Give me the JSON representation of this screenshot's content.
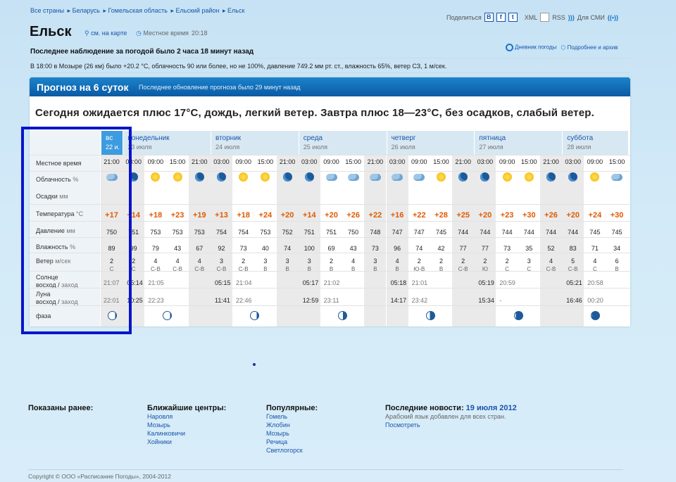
{
  "breadcrumb": [
    "Все страны",
    "Беларусь",
    "Гомельская область",
    "Ельский район",
    "Ельск"
  ],
  "city": "Ельск",
  "map_link": "см. на карте",
  "local_time_label": "Местное время",
  "local_time": "20:18",
  "share": {
    "label": "Поделиться",
    "xml": "XML",
    "rss": "RSS",
    "media": "Для СМИ",
    "b": "B",
    "f": "f",
    "t": "t"
  },
  "last_obs": "Последнее наблюдение за погодой было 2 часа 18 минут назад",
  "links": {
    "diary": "Дневник погоды",
    "archive": "Подробнее и архив"
  },
  "obs_text": "В 18:00 в Мозыре (26 км) было +20.2 °C, облачность 90 или более, но не 100%, давление 749.2 мм рт. ст., влажность 65%, ветер СЗ, 1 м/сек.",
  "forecast": {
    "title": "Прогноз на 6 суток",
    "updated": "Последнее обновление прогноза было 29 минут назад",
    "summary": "Сегодня ожидается плюс 17°C, дождь, легкий ветер. Завтра плюс 18—23°C, без осадков, слабый ветер."
  },
  "labels": {
    "time": "Местное время",
    "cloud": "Облачность",
    "cloud_unit": "%",
    "precip": "Осадки",
    "precip_unit": "мм",
    "temp": "Температура",
    "temp_unit": "°C",
    "press": "Давление",
    "press_unit": "мм",
    "hum": "Влажность",
    "hum_unit": "%",
    "wind": "Ветер",
    "wind_unit": "м/сек",
    "sun": "Солнце",
    "sunrise": "восход",
    "sunset": "заход",
    "moon": "Луна",
    "phase": "фаза"
  },
  "days": [
    {
      "name": "вс",
      "date": "22 и."
    },
    {
      "name": "понедельник",
      "date": "23 июля"
    },
    {
      "name": "вторник",
      "date": "24 июля"
    },
    {
      "name": "среда",
      "date": "25 июля"
    },
    {
      "name": "четверг",
      "date": "26 июля"
    },
    {
      "name": "пятница",
      "date": "27 июля"
    },
    {
      "name": "суббота",
      "date": "28 июля"
    }
  ],
  "cols": [
    {
      "t": "21:00",
      "icon": "cloud",
      "temp": "+17",
      "p": "750",
      "h": "89",
      "ws": "2",
      "wd": "С"
    },
    {
      "t": "03:00",
      "icon": "moon",
      "temp": "+14",
      "p": "751",
      "h": "99",
      "ws": "2",
      "wd": "С"
    },
    {
      "t": "09:00",
      "icon": "sun",
      "temp": "+18",
      "p": "753",
      "h": "79",
      "ws": "4",
      "wd": "С-В"
    },
    {
      "t": "15:00",
      "icon": "sun",
      "temp": "+23",
      "p": "753",
      "h": "43",
      "ws": "4",
      "wd": "С-В"
    },
    {
      "t": "21:00",
      "icon": "moon",
      "temp": "+19",
      "p": "753",
      "h": "67",
      "ws": "4",
      "wd": "С-В"
    },
    {
      "t": "03:00",
      "icon": "moon",
      "temp": "+13",
      "p": "754",
      "h": "92",
      "ws": "3",
      "wd": "С-В"
    },
    {
      "t": "09:00",
      "icon": "sun",
      "temp": "+18",
      "p": "754",
      "h": "73",
      "ws": "2",
      "wd": "С-В"
    },
    {
      "t": "15:00",
      "icon": "sun",
      "temp": "+24",
      "p": "753",
      "h": "40",
      "ws": "3",
      "wd": "В"
    },
    {
      "t": "21:00",
      "icon": "moon",
      "temp": "+20",
      "p": "752",
      "h": "74",
      "ws": "3",
      "wd": "В"
    },
    {
      "t": "03:00",
      "icon": "moon",
      "temp": "+14",
      "p": "751",
      "h": "100",
      "ws": "3",
      "wd": "В"
    },
    {
      "t": "09:00",
      "icon": "cloud",
      "temp": "+20",
      "p": "751",
      "h": "69",
      "ws": "2",
      "wd": "В"
    },
    {
      "t": "15:00",
      "icon": "cloud",
      "temp": "+26",
      "p": "750",
      "h": "43",
      "ws": "4",
      "wd": "В"
    },
    {
      "t": "21:00",
      "icon": "cloud",
      "temp": "+22",
      "p": "748",
      "h": "73",
      "ws": "3",
      "wd": "В"
    },
    {
      "t": "03:00",
      "icon": "cloud",
      "temp": "+16",
      "p": "747",
      "h": "96",
      "ws": "4",
      "wd": "В"
    },
    {
      "t": "09:00",
      "icon": "cloud",
      "temp": "+22",
      "p": "747",
      "h": "74",
      "ws": "2",
      "wd": "Ю-В"
    },
    {
      "t": "15:00",
      "icon": "sun",
      "temp": "+28",
      "p": "745",
      "h": "42",
      "ws": "2",
      "wd": "В"
    },
    {
      "t": "21:00",
      "icon": "moon",
      "temp": "+25",
      "p": "744",
      "h": "77",
      "ws": "2",
      "wd": "С-В"
    },
    {
      "t": "03:00",
      "icon": "moon",
      "temp": "+20",
      "p": "744",
      "h": "77",
      "ws": "2",
      "wd": "Ю"
    },
    {
      "t": "09:00",
      "icon": "sun",
      "temp": "+23",
      "p": "744",
      "h": "73",
      "ws": "2",
      "wd": "С"
    },
    {
      "t": "15:00",
      "icon": "sun",
      "temp": "+30",
      "p": "744",
      "h": "35",
      "ws": "3",
      "wd": "С"
    },
    {
      "t": "21:00",
      "icon": "moon",
      "temp": "+26",
      "p": "744",
      "h": "52",
      "ws": "4",
      "wd": "С-В"
    },
    {
      "t": "03:00",
      "icon": "moon",
      "temp": "+20",
      "p": "744",
      "h": "83",
      "ws": "5",
      "wd": "С-В"
    },
    {
      "t": "09:00",
      "icon": "sun",
      "temp": "+24",
      "p": "745",
      "h": "71",
      "ws": "4",
      "wd": "С"
    },
    {
      "t": "15:00",
      "icon": "cloud",
      "temp": "+30",
      "p": "745",
      "h": "34",
      "ws": "6",
      "wd": "В"
    }
  ],
  "sun": [
    [
      "",
      "21:07"
    ],
    [
      "05:14",
      "21:05"
    ],
    [
      "05:15",
      "21:04"
    ],
    [
      "05:17",
      "21:02"
    ],
    [
      "05:18",
      "21:01"
    ],
    [
      "05:19",
      "20:59"
    ],
    [
      "05:21",
      "20:58"
    ]
  ],
  "moon": [
    [
      "",
      "22:01"
    ],
    [
      "10:25",
      "22:23"
    ],
    [
      "11:41",
      "22:46"
    ],
    [
      "12:59",
      "23:11"
    ],
    [
      "14:17",
      "23:42"
    ],
    [
      "15:34",
      "-"
    ],
    [
      "16:46",
      "00:20"
    ]
  ],
  "footer": {
    "shown": "Показаны ранее:",
    "centers_title": "Ближайшие центры:",
    "centers": [
      "Наровля",
      "Мозырь",
      "Калинковичи",
      "Хойники"
    ],
    "popular_title": "Популярные:",
    "popular": [
      "Гомель",
      "Жлобин",
      "Мозырь",
      "Речица",
      "Светлогорск"
    ],
    "news_title": "Последние новости:",
    "news_date": "19 июля 2012",
    "news_text": "Арабский язык добавлен для всех стран.",
    "news_link": "Посмотреть",
    "copy": "Copyright © ООО «Расписание Погоды», 2004-2012"
  }
}
